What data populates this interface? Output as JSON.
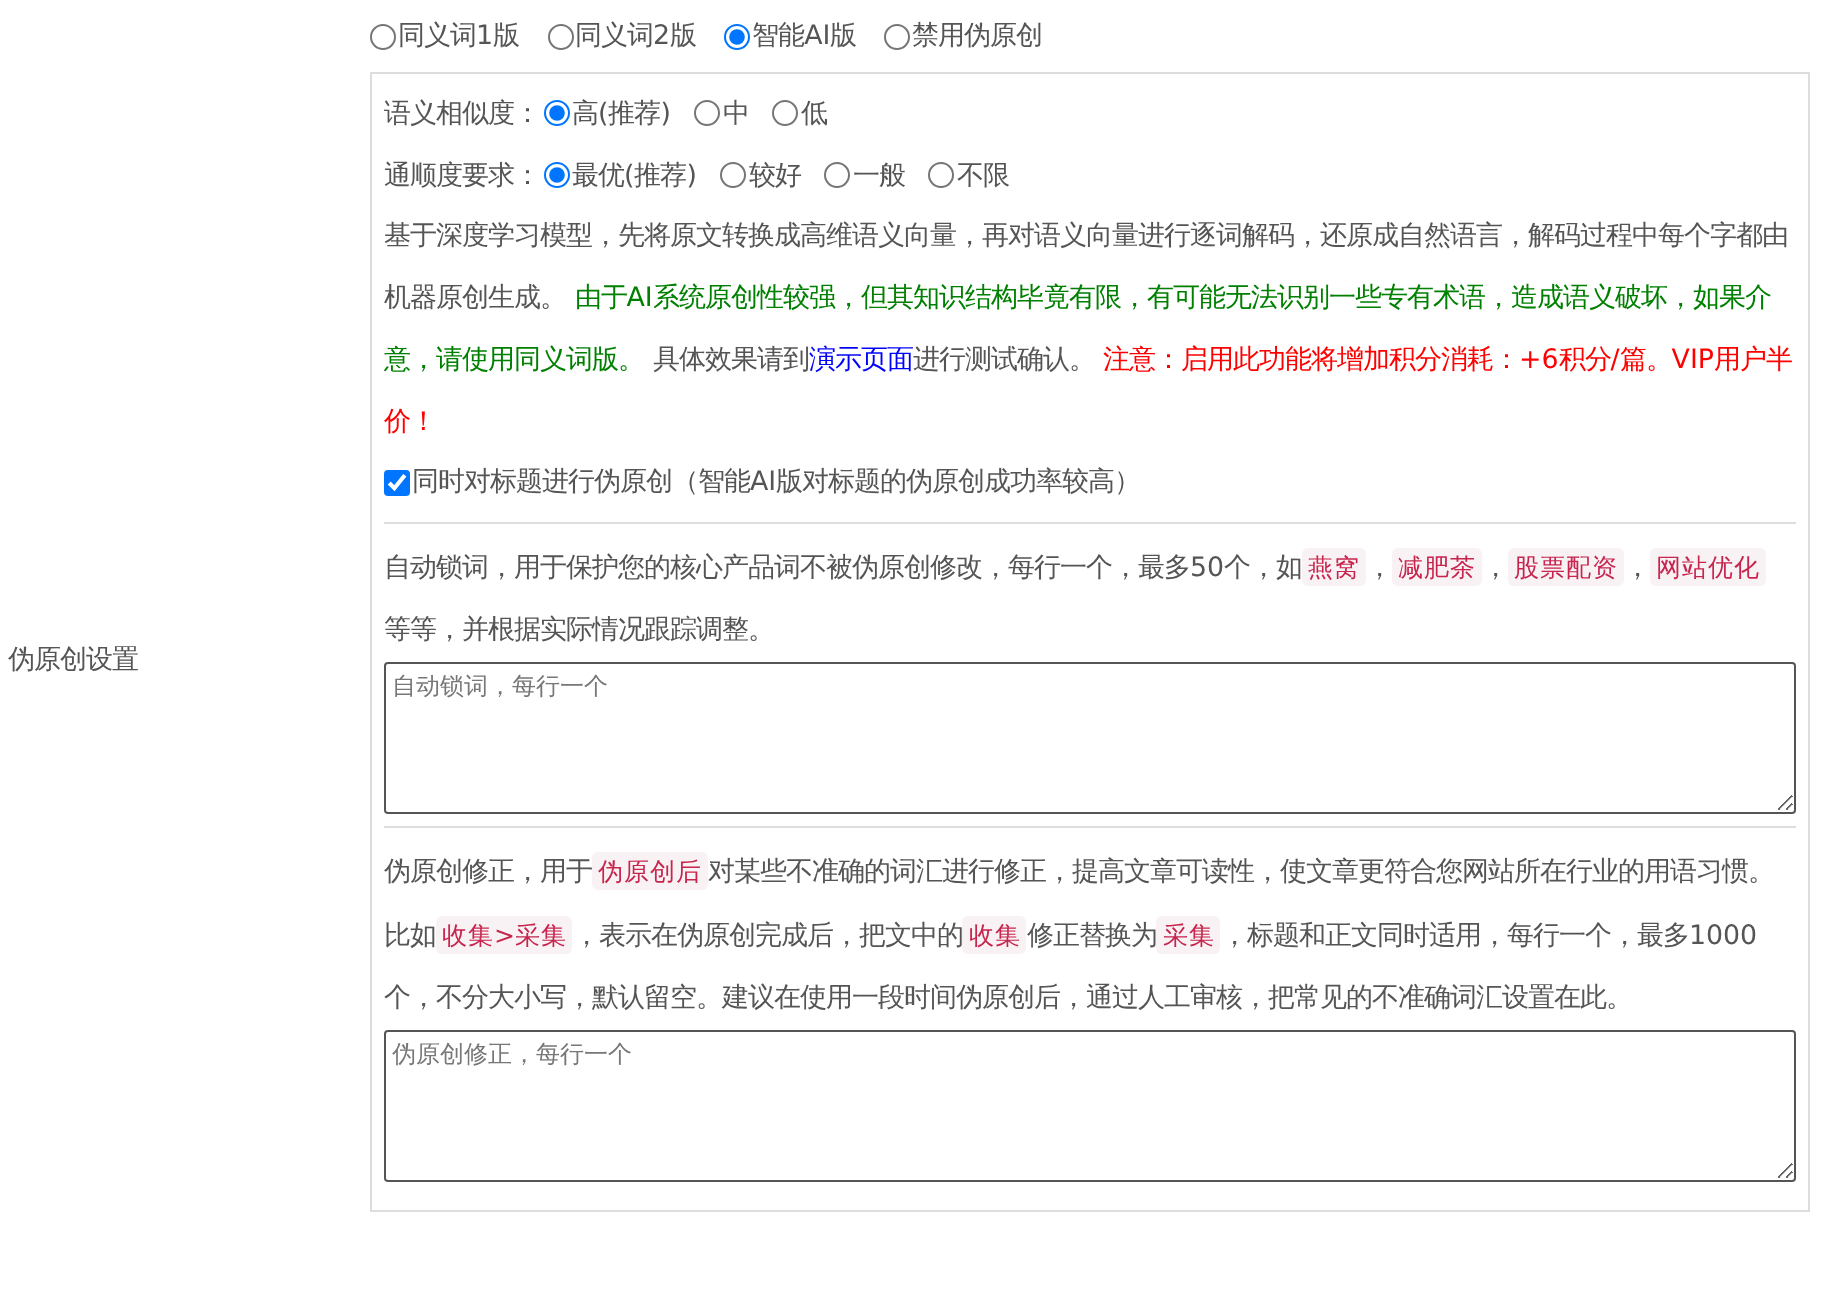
{
  "section_label": "伪原创设置",
  "versions": [
    {
      "label": "同义词1版",
      "selected": false
    },
    {
      "label": "同义词2版",
      "selected": false
    },
    {
      "label": "智能AI版",
      "selected": true
    },
    {
      "label": "禁用伪原创",
      "selected": false
    }
  ],
  "option_groups": [
    {
      "label": "语义相似度：",
      "options": [
        {
          "label": "高(推荐)",
          "selected": true
        },
        {
          "label": "中",
          "selected": false
        },
        {
          "label": "低",
          "selected": false
        }
      ]
    },
    {
      "label": "通顺度要求：",
      "options": [
        {
          "label": "最优(推荐)",
          "selected": true
        },
        {
          "label": "较好",
          "selected": false
        },
        {
          "label": "一般",
          "selected": false
        },
        {
          "label": "不限",
          "selected": false
        }
      ]
    }
  ],
  "description": [
    {
      "kind": "text",
      "text": "基于深度学习模型，先将原文转换成高维语义向量，再对语义向量进行逐词解码，还原成自然语言，解码过程中每个字都由机器原创生成。 "
    },
    {
      "kind": "notice",
      "text": "由于AI系统原创性较强，但其知识结构毕竟有限，有可能无法识别一些专有术语，造成语义破坏，如果介意，请使用同义词版。"
    },
    {
      "kind": "text",
      "text": " 具体效果请到"
    },
    {
      "kind": "link",
      "text": "演示页面"
    },
    {
      "kind": "text",
      "text": "进行测试确认。 "
    },
    {
      "kind": "warning",
      "text": "注意：启用此功能将增加积分消耗：+6积分/篇。VIP用户半价！"
    }
  ],
  "title_option": {
    "label": "同时对标题进行伪原创（智能AI版对标题的伪原创成功率较高）",
    "checked": true
  },
  "word_sections": [
    {
      "description": [
        {
          "kind": "text",
          "text": "自动锁词，用于保护您的核心产品词不被伪原创修改，每行一个，最多50个，如"
        },
        {
          "kind": "code",
          "text": "燕窝"
        },
        {
          "kind": "text",
          "text": "，"
        },
        {
          "kind": "code",
          "text": "减肥茶"
        },
        {
          "kind": "text",
          "text": "，"
        },
        {
          "kind": "code",
          "text": "股票配资"
        },
        {
          "kind": "text",
          "text": "，"
        },
        {
          "kind": "code",
          "text": "网站优化"
        },
        {
          "kind": "text",
          "text": " 等等，并根据实际情况跟踪调整。"
        }
      ],
      "placeholder": "自动锁词，每行一个"
    },
    {
      "description": [
        {
          "kind": "text",
          "text": "伪原创修正，用于"
        },
        {
          "kind": "code",
          "text": "伪原创后"
        },
        {
          "kind": "text",
          "text": "对某些不准确的词汇进行修正，提高文章可读性，使文章更符合您网站所在行业的用语习惯。比如"
        },
        {
          "kind": "code",
          "text": "收集>采集"
        },
        {
          "kind": "text",
          "text": "，表示在伪原创完成后，把文中的"
        },
        {
          "kind": "code",
          "text": "收集"
        },
        {
          "kind": "text",
          "text": "修正替换为"
        },
        {
          "kind": "code",
          "text": "采集"
        },
        {
          "kind": "text",
          "text": "，标题和正文同时适用，每行一个，最多1000个，不分大小写，默认留空。建议在使用一段时间伪原创后，通过人工审核，把常见的不准确词汇设置在此。"
        }
      ],
      "placeholder": "伪原创修正，每行一个"
    }
  ]
}
